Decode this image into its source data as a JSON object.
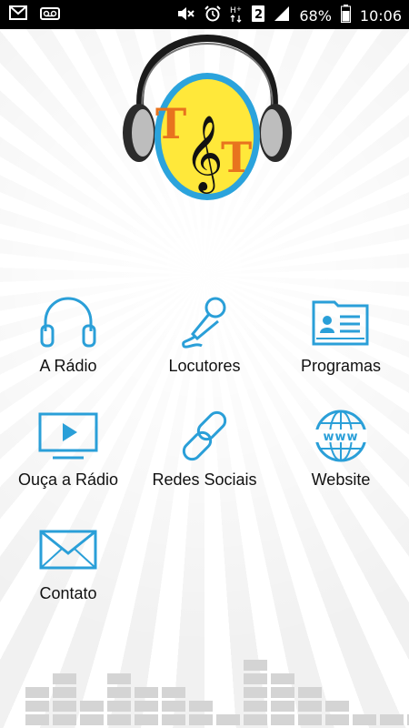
{
  "status_bar": {
    "left_icons": [
      "message-icon",
      "voicemail-icon"
    ],
    "battery_text": "68%",
    "time": "10:06",
    "right_icons": [
      "mute-icon",
      "alarm-icon",
      "hplus-signal-icon",
      "sim-2-icon",
      "signal-icon",
      "battery-icon"
    ]
  },
  "logo": {
    "letters": [
      "T",
      "T"
    ],
    "glyph": "𝄞"
  },
  "colors": {
    "icon_blue": "#2a9fd8",
    "logo_yellow": "#ffe83a",
    "logo_ring": "#2ba3dc",
    "logo_letter": "#e8731e"
  },
  "menu": [
    {
      "label": "A Rádio",
      "icon": "headphones-icon"
    },
    {
      "label": "Locutores",
      "icon": "microphone-icon"
    },
    {
      "label": "Programas",
      "icon": "folder-id-card-icon"
    },
    {
      "label": "Ouça a Rádio",
      "icon": "tv-play-icon"
    },
    {
      "label": "Redes Sociais",
      "icon": "chain-link-icon"
    },
    {
      "label": "Website",
      "icon": "globe-www-icon"
    },
    {
      "label": "Contato",
      "icon": "envelope-icon"
    }
  ]
}
